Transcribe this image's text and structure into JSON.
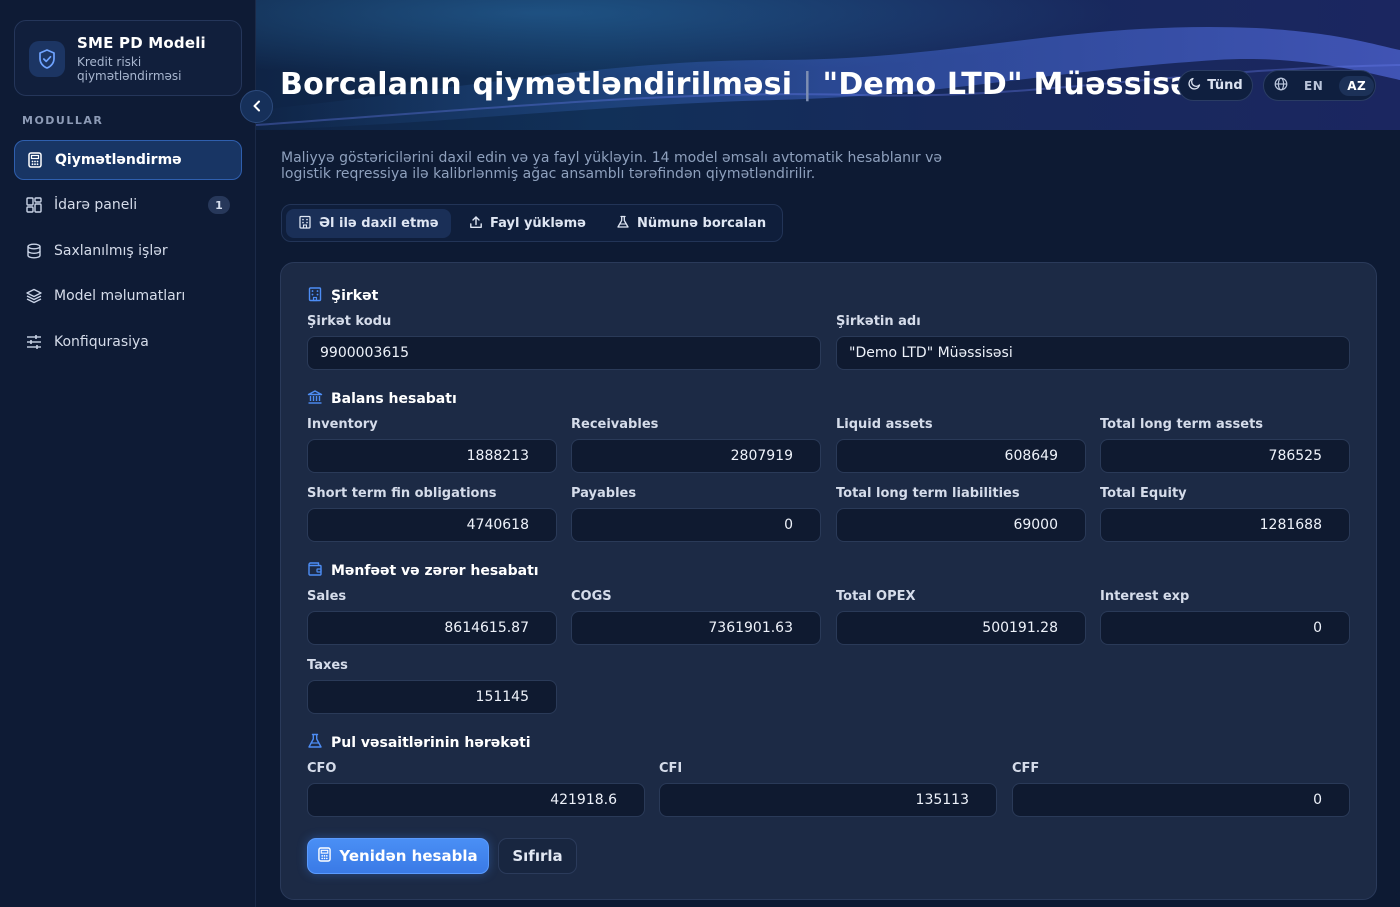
{
  "brand": {
    "title": "SME PD Modeli",
    "subtitle": "Kredit riski qiymətləndirməsi",
    "icon": "shield-check-icon"
  },
  "sidebar": {
    "section_label": "MODULLAR",
    "items": [
      {
        "label": "Qiymətləndirmə",
        "icon": "calculator-icon",
        "active": true
      },
      {
        "label": "İdarə paneli",
        "icon": "dashboard-icon",
        "badge": "1"
      },
      {
        "label": "Saxlanılmış işlər",
        "icon": "database-icon"
      },
      {
        "label": "Model məlumatları",
        "icon": "layers-icon"
      },
      {
        "label": "Konfiqurasiya",
        "icon": "sliders-icon"
      }
    ]
  },
  "header": {
    "title": "Borcalanın qiymətləndirilməsi",
    "separator": "|",
    "company": "\"Demo LTD\" Müəssisəsi",
    "theme_label": "Tünd",
    "lang": {
      "en": "EN",
      "az": "AZ",
      "active": "AZ"
    }
  },
  "intro": "Maliyyə göstəricilərini daxil edin və ya fayl yükləyin. 14 model əmsalı avtomatik hesablanır və logistik reqressiya ilə kalibrlənmiş ağac ansamblı tərəfindən qiymətləndirilir.",
  "tabs": [
    {
      "label": "Əl ilə daxil etmə",
      "icon": "building-icon",
      "active": true
    },
    {
      "label": "Fayl yükləmə",
      "icon": "upload-icon"
    },
    {
      "label": "Nümunə borcalan",
      "icon": "flask-icon"
    }
  ],
  "form": {
    "company": {
      "title": "Şirkət",
      "code_label": "Şirkət kodu",
      "code_value": "9900003615",
      "name_label": "Şirkətin adı",
      "name_value": "\"Demo LTD\" Müəssisəsi"
    },
    "balance": {
      "title": "Balans hesabatı",
      "fields": [
        {
          "label": "Inventory",
          "value": "1888213"
        },
        {
          "label": "Receivables",
          "value": "2807919"
        },
        {
          "label": "Liquid assets",
          "value": "608649"
        },
        {
          "label": "Total long term assets",
          "value": "786525"
        },
        {
          "label": "Short term fin obligations",
          "value": "4740618"
        },
        {
          "label": "Payables",
          "value": "0"
        },
        {
          "label": "Total long term liabilities",
          "value": "69000"
        },
        {
          "label": "Total Equity",
          "value": "1281688"
        }
      ]
    },
    "pnl": {
      "title": "Mənfəət və zərər hesabatı",
      "fields": [
        {
          "label": "Sales",
          "value": "8614615.87"
        },
        {
          "label": "COGS",
          "value": "7361901.63"
        },
        {
          "label": "Total OPEX",
          "value": "500191.28"
        },
        {
          "label": "Interest exp",
          "value": "0"
        },
        {
          "label": "Taxes",
          "value": "151145"
        }
      ]
    },
    "cashflow": {
      "title": "Pul vəsaitlərinin hərəkəti",
      "fields": [
        {
          "label": "CFO",
          "value": "421918.6"
        },
        {
          "label": "CFI",
          "value": "135113"
        },
        {
          "label": "CFF",
          "value": "0"
        }
      ]
    },
    "recalc_label": "Yenidən hesabla",
    "reset_label": "Sıfırla"
  },
  "colors": {
    "accent": "#3f86f0",
    "sidebar_bg": "#0e1b35",
    "card_bg": "#1c2a45"
  }
}
